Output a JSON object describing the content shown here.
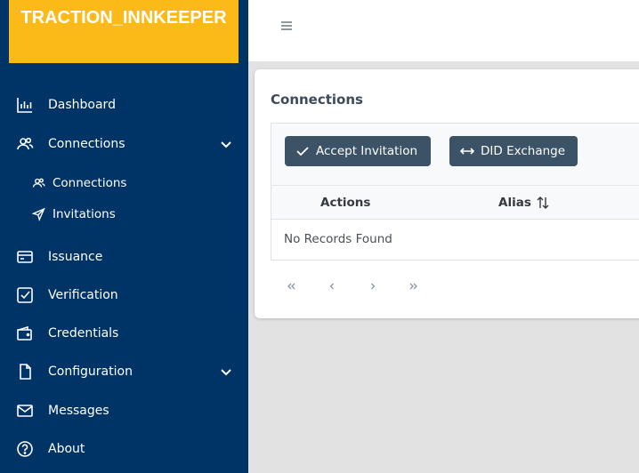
{
  "app": {
    "logo_text": "TRACTION_INNKEEPER"
  },
  "sidebar": {
    "items": [
      {
        "label": "Dashboard",
        "icon": "chart-bar-icon"
      },
      {
        "label": "Connections",
        "icon": "users-icon",
        "expandable": true
      },
      {
        "label": "Connections",
        "icon": "users-icon",
        "sub": true
      },
      {
        "label": "Invitations",
        "icon": "send-icon",
        "sub": true
      },
      {
        "label": "Issuance",
        "icon": "credit-card-icon"
      },
      {
        "label": "Verification",
        "icon": "check-square-icon"
      },
      {
        "label": "Credentials",
        "icon": "wallet-icon"
      },
      {
        "label": "Configuration",
        "icon": "file-icon",
        "expandable": true
      },
      {
        "label": "Messages",
        "icon": "envelope-icon"
      },
      {
        "label": "About",
        "icon": "question-circle-icon"
      }
    ]
  },
  "colors": {
    "sidebar_bg": "#003366",
    "logo_bg": "#fcba19",
    "button_bg": "#3c5267"
  },
  "main": {
    "title": "Connections",
    "buttons": {
      "accept_invitation": "Accept Invitation",
      "did_exchange": "DID Exchange"
    },
    "table": {
      "columns": [
        "Actions",
        "Alias"
      ],
      "empty_message": "No Records Found"
    }
  }
}
